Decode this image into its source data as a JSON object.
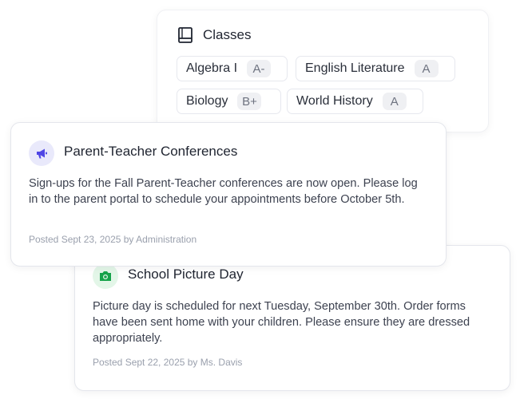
{
  "classes": {
    "title": "Classes",
    "icon": "book-icon",
    "items": [
      {
        "name": "Algebra I",
        "grade": "A-"
      },
      {
        "name": "English Literature",
        "grade": "A"
      },
      {
        "name": "Biology",
        "grade": "B+"
      },
      {
        "name": "World History",
        "grade": "A"
      }
    ]
  },
  "announcements": [
    {
      "title": "Parent-Teacher Conferences",
      "icon": "megaphone-icon",
      "icon_color": "#4f46e5",
      "icon_bg": "#e9e9fb",
      "body": "Sign-ups for the Fall Parent-Teacher conferences are now open. Please log in to the parent portal to schedule your appointments before October 5th.",
      "meta": "Posted Sept 23, 2025 by Administration"
    },
    {
      "title": "School Picture Day",
      "icon": "camera-icon",
      "icon_color": "#16a34a",
      "icon_bg": "#e3f6e8",
      "body": "Picture day is scheduled for next Tuesday, September 30th. Order forms have been sent home with your children. Please ensure they are dressed appropriately.",
      "meta": "Posted Sept 22, 2025 by Ms. Davis"
    }
  ]
}
